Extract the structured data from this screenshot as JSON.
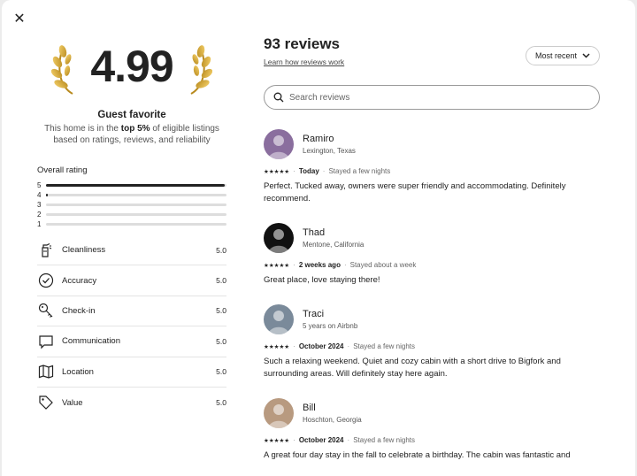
{
  "close_label": "✕",
  "summary": {
    "score": "4.99",
    "badge_title": "Guest favorite",
    "badge_sub_pre": "This home is in the ",
    "badge_sub_bold": "top 5%",
    "badge_sub_post": " of eligible listings based on ratings, reviews, and reliability"
  },
  "overall": {
    "title": "Overall rating",
    "bars": [
      {
        "label": "5",
        "fraction": 0.99
      },
      {
        "label": "4",
        "fraction": 0.01
      },
      {
        "label": "3",
        "fraction": 0
      },
      {
        "label": "2",
        "fraction": 0
      },
      {
        "label": "1",
        "fraction": 0
      }
    ]
  },
  "categories": [
    {
      "label": "Cleanliness",
      "value": "5.0",
      "icon": "spray-bottle-icon"
    },
    {
      "label": "Accuracy",
      "value": "5.0",
      "icon": "check-circle-icon"
    },
    {
      "label": "Check-in",
      "value": "5.0",
      "icon": "key-icon"
    },
    {
      "label": "Communication",
      "value": "5.0",
      "icon": "chat-bubble-icon"
    },
    {
      "label": "Location",
      "value": "5.0",
      "icon": "map-icon"
    },
    {
      "label": "Value",
      "value": "5.0",
      "icon": "tag-icon"
    }
  ],
  "reviews_header": {
    "title": "93 reviews",
    "learn_link": "Learn how reviews work",
    "sort_label": "Most recent"
  },
  "search": {
    "placeholder": "Search reviews"
  },
  "reviews": [
    {
      "name": "Ramiro",
      "location": "Lexington, Texas",
      "stars": "★★★★★",
      "date": "Today",
      "stay": "Stayed a few nights",
      "text": "Perfect. Tucked away, owners were super friendly and accommodating. Definitely recommend.",
      "avatar_color": "#8a6e9e"
    },
    {
      "name": "Thad",
      "location": "Mentone, California",
      "stars": "★★★★★",
      "date": "2 weeks ago",
      "stay": "Stayed about a week",
      "text": "Great place, love staying there!",
      "avatar_color": "#111111"
    },
    {
      "name": "Traci",
      "location": "5 years on Airbnb",
      "stars": "★★★★★",
      "date": "October 2024",
      "stay": "Stayed a few nights",
      "text": "Such a relaxing weekend. Quiet and cozy cabin with a short drive to Bigfork and surrounding areas. Will definitely stay here again.",
      "avatar_color": "#7a8a9a"
    },
    {
      "name": "Bill",
      "location": "Hoschton, Georgia",
      "stars": "★★★★★",
      "date": "October 2024",
      "stay": "Stayed a few nights",
      "text": "A great four day stay in the fall to celebrate a birthday. The cabin was fantastic and",
      "avatar_color": "#b89a80"
    }
  ],
  "meta_separator": "·"
}
